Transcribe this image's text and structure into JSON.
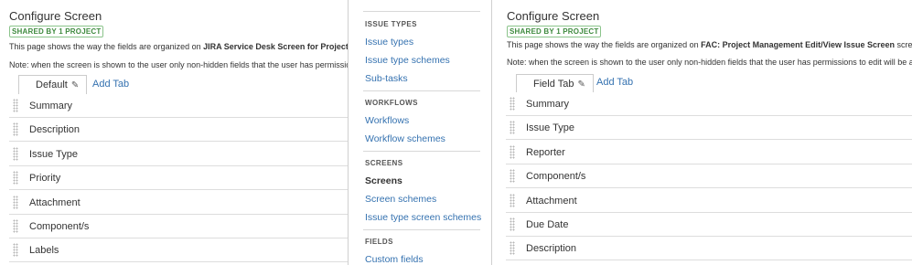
{
  "left_screen": {
    "title": "Configure Screen",
    "badge": "SHARED BY 1 PROJECT",
    "desc_prefix": "This page shows the way the fields are organized on ",
    "desc_bold": "JIRA Service Desk Screen for Project IT",
    "desc_suffix": "",
    "note": "Note: when the screen is shown to the user only non-hidden fields that the user has permissions",
    "active_tab": "Default",
    "add_tab": "Add Tab",
    "fields": [
      "Summary",
      "Description",
      "Issue Type",
      "Priority",
      "Attachment",
      "Component/s",
      "Labels"
    ]
  },
  "sidebar": {
    "sections": [
      {
        "heading": "ISSUE TYPES",
        "items": [
          "Issue types",
          "Issue type schemes",
          "Sub-tasks"
        ]
      },
      {
        "heading": "WORKFLOWS",
        "items": [
          "Workflows",
          "Workflow schemes"
        ]
      },
      {
        "heading": "SCREENS",
        "items": [
          "Screens",
          "Screen schemes",
          "Issue type screen schemes"
        ]
      },
      {
        "heading": "FIELDS",
        "items": [
          "Custom fields"
        ]
      }
    ],
    "active_item": "Screens"
  },
  "right_screen": {
    "title": "Configure Screen",
    "badge": "SHARED BY 1 PROJECT",
    "desc_prefix": "This page shows the way the fields are organized on ",
    "desc_bold": "FAC: Project Management Edit/View Issue Screen",
    "desc_suffix": " screen.",
    "note": "Note: when the screen is shown to the user only non-hidden fields that the user has permissions to edit will be actua",
    "active_tab": "Field Tab",
    "add_tab": "Add Tab",
    "fields": [
      "Summary",
      "Issue Type",
      "Reporter",
      "Component/s",
      "Attachment",
      "Due Date",
      "Description"
    ]
  },
  "colors": {
    "link": "#3572b0",
    "badge_green": "#3f8a3f",
    "border": "#dddddd"
  }
}
